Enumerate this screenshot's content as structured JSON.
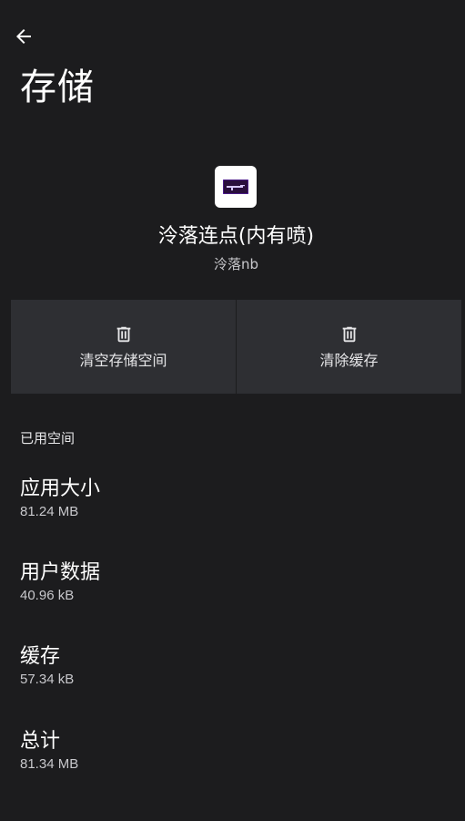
{
  "header": {
    "back_icon": "arrow-left-icon",
    "title": "存储"
  },
  "app": {
    "icon": "app-logo-icon",
    "name": "泠落连点(内有喷)",
    "developer": "泠落nb"
  },
  "actions": [
    {
      "label": "清空存储空间",
      "icon": "trash-icon"
    },
    {
      "label": "清除缓存",
      "icon": "trash-icon"
    }
  ],
  "section": {
    "title": "已用空间"
  },
  "storage_items": [
    {
      "label": "应用大小",
      "value": "81.24 MB"
    },
    {
      "label": "用户数据",
      "value": "40.96 kB"
    },
    {
      "label": "缓存",
      "value": "57.34 kB"
    },
    {
      "label": "总计",
      "value": "81.34 MB"
    }
  ],
  "colors": {
    "background": "#1c1c1e",
    "card": "#2e2f33",
    "text_primary": "#ffffff",
    "text_secondary": "#c8c8cc"
  }
}
